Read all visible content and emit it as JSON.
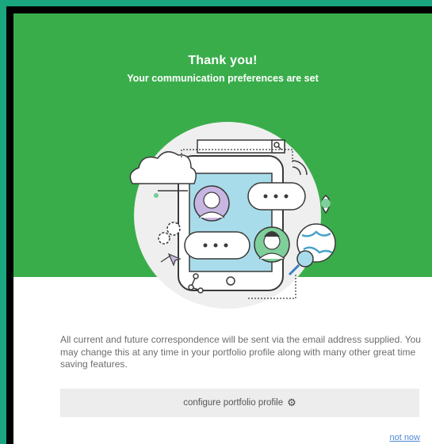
{
  "header": {
    "title": "Thank you!",
    "subtitle": "Your communication preferences are set"
  },
  "illustration": {
    "name": "communication-illustration",
    "icons": [
      "search-icon",
      "cloud-icon",
      "gear-icon",
      "cursor-icon",
      "wifi-icon",
      "map-pin-icon",
      "globe-icon",
      "magnifier-icon",
      "share-icon"
    ]
  },
  "body": {
    "text": "All current and future correspondence will be sent via the email address supplied. You may change this at any time in your portfolio profile along with many other great time saving features."
  },
  "actions": {
    "configure_label": "configure portfolio profile",
    "not_now_label": "not now"
  },
  "colors": {
    "border": "#1aa67e",
    "hero": "#3aad4b",
    "button_bg": "#ededed",
    "link": "#4f8bd6"
  }
}
